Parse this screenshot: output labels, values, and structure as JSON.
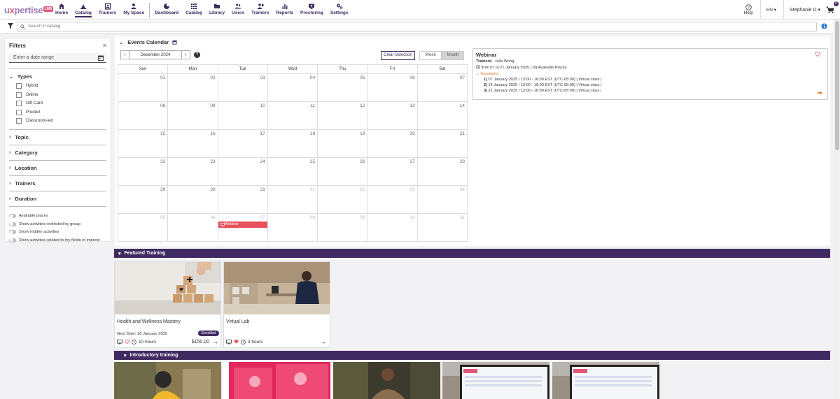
{
  "app": {
    "logo_main": "u",
    "logo_x": "x",
    "logo_rest": "pertise",
    "logo_badge": "LMS"
  },
  "nav": {
    "left": [
      {
        "label": "Home",
        "icon": "home-icon"
      },
      {
        "label": "Catalog",
        "icon": "catalog-icon",
        "active": true
      },
      {
        "label": "Trainers",
        "icon": "trainers-icon"
      },
      {
        "label": "My Space",
        "icon": "myspace-icon"
      }
    ],
    "right": [
      {
        "label": "Dashboard",
        "icon": "dashboard-icon"
      },
      {
        "label": "Catalog",
        "icon": "grid-icon"
      },
      {
        "label": "Library",
        "icon": "folder-icon"
      },
      {
        "label": "Users",
        "icon": "users-icon"
      },
      {
        "label": "Trainers",
        "icon": "trainers-icon"
      },
      {
        "label": "Reports",
        "icon": "reports-icon"
      },
      {
        "label": "Proctoring",
        "icon": "proctoring-icon"
      },
      {
        "label": "Settings",
        "icon": "settings-icon"
      }
    ]
  },
  "header": {
    "help": "Help",
    "lang": "EN",
    "user": "Stephanie D",
    "cart_count": "0"
  },
  "search": {
    "placeholder": "Search in catalog"
  },
  "filters": {
    "title": "Filters",
    "date_placeholder": "Enter a date range",
    "types_label": "Types",
    "types": [
      "Hybrid",
      "Online",
      "Gift Card",
      "Product",
      "Classroom-led"
    ],
    "sections": [
      "Topic",
      "Category",
      "Location",
      "Trainers",
      "Duration"
    ],
    "toggles": [
      "Available places",
      "Show activities restricted by group",
      "Show hidden activities",
      "Show activities related to my fields of interest"
    ]
  },
  "calendar": {
    "title": "Events Calendar",
    "month": "December 2024",
    "clear_selection": "Clear Selection",
    "week_label": "Week",
    "month_label": "Month",
    "days": [
      "Sun",
      "Mon",
      "Tue",
      "Wed",
      "Thu",
      "Fri",
      "Sat"
    ],
    "weeks": [
      [
        "01",
        "02",
        "03",
        "04",
        "05",
        "06",
        "07"
      ],
      [
        "08",
        "09",
        "10",
        "11",
        "12",
        "13",
        "14"
      ],
      [
        "15",
        "16",
        "17",
        "18",
        "19",
        "20",
        "21"
      ],
      [
        "22",
        "23",
        "24",
        "25",
        "26",
        "27",
        "28"
      ],
      [
        "29",
        "30",
        "31",
        "01",
        "02",
        "03",
        "04"
      ],
      [
        "05",
        "06",
        "07",
        "08",
        "09",
        "10",
        "11"
      ]
    ],
    "event_label": "Webinar"
  },
  "webinar": {
    "title": "Webinar",
    "trainers_label": "Trainers:",
    "trainers": "Julia Wong",
    "dates": "from 07 to 21 January 2025 | (9) Available Places",
    "sessions_label": "Session(s)",
    "sessions": [
      {
        "num": "1)",
        "text": "07 January 2025 / 13:00 - 16:00 EST (UTC-05:00) |  Virtual class |"
      },
      {
        "num": "2)",
        "text": "14 January 2025 / 13:00 - 16:00 EST (UTC-05:00) |  Virtual class |"
      },
      {
        "num": "3)",
        "text": "21 January 2025 / 13:00 - 16:00 EST (UTC-05:00) |  Virtual class |"
      }
    ]
  },
  "featured": {
    "title": "Featured Training",
    "cards": [
      {
        "title": "Health and Wellness Mastery",
        "next_date": "Next Date: 16 January 2025",
        "badge": "Enrolled",
        "duration": "10 hours",
        "price": "$150.00"
      },
      {
        "title": "Virtual Lab",
        "duration": "3 hours"
      }
    ]
  },
  "introductory": {
    "title": "Introductory training"
  },
  "colors": {
    "primary": "#3f2b61",
    "accent": "#e2577a",
    "event": "#e8505b",
    "orange": "#e2711d"
  }
}
